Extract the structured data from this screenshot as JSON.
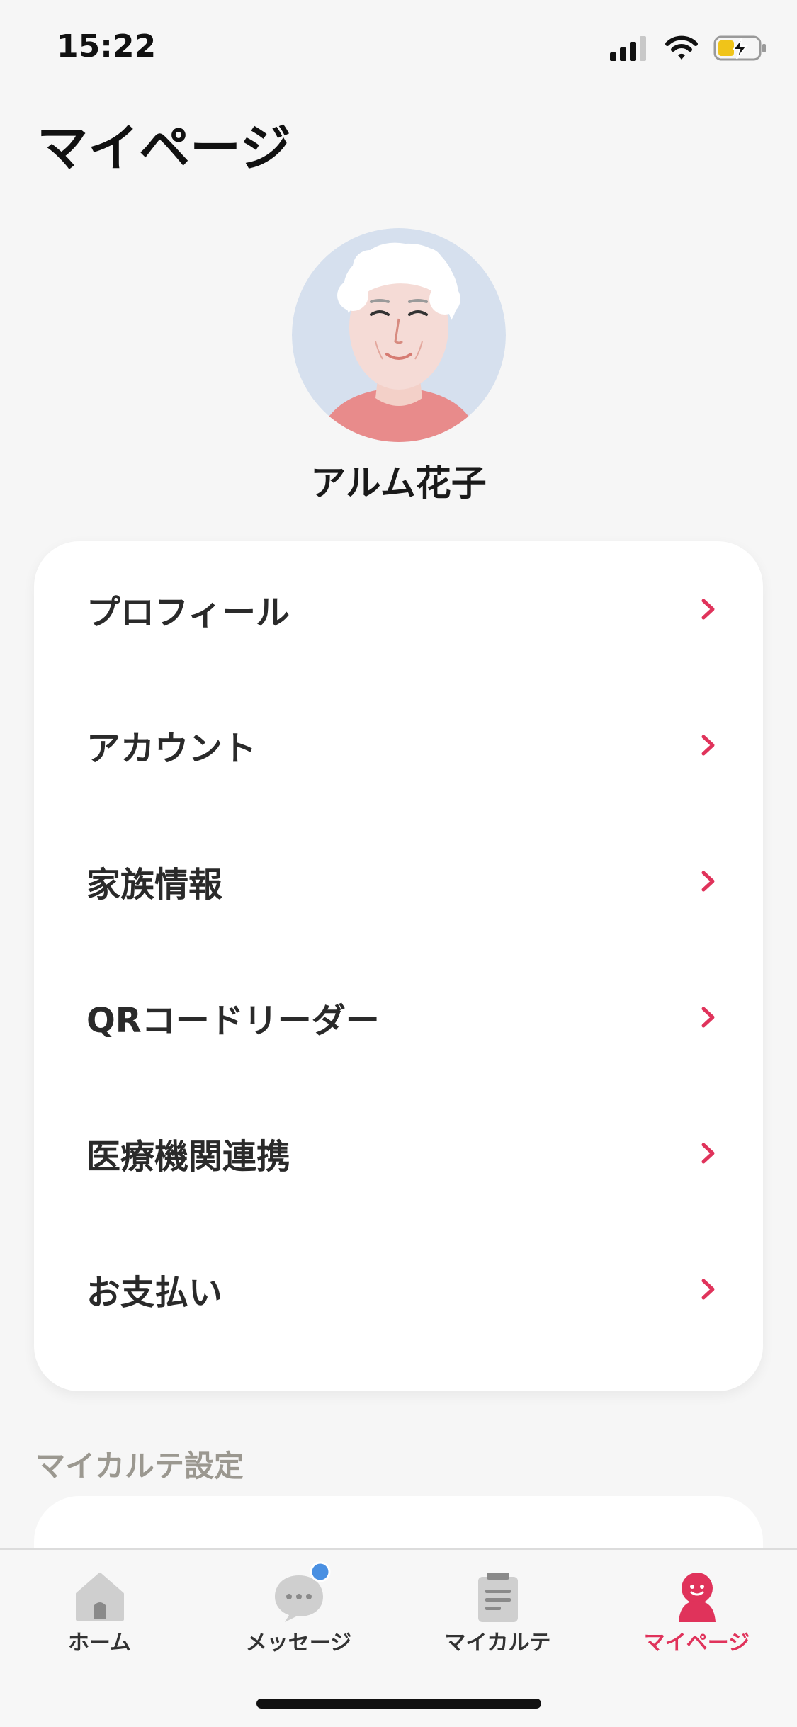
{
  "status_bar": {
    "time": "15:22"
  },
  "page": {
    "title": "マイページ"
  },
  "profile": {
    "name": "アルム花子"
  },
  "menu": {
    "items": [
      {
        "label": "プロフィール"
      },
      {
        "label": "アカウント"
      },
      {
        "label": "家族情報"
      },
      {
        "label": "QRコードリーダー"
      },
      {
        "label": "医療機関連携"
      },
      {
        "label": "お支払い"
      }
    ]
  },
  "karte_settings": {
    "section_label": "マイカルテ設定"
  },
  "tab_bar": {
    "tabs": [
      {
        "label": "ホーム",
        "icon": "house-icon"
      },
      {
        "label": "メッセージ",
        "icon": "chat-bubble-icon",
        "badge": true
      },
      {
        "label": "マイカルテ",
        "icon": "clipboard-icon"
      },
      {
        "label": "マイページ",
        "icon": "person-icon",
        "active": true
      }
    ]
  },
  "colors": {
    "accent": "#e0335b",
    "badge": "#4a90e2",
    "background": "#f6f6f6"
  }
}
